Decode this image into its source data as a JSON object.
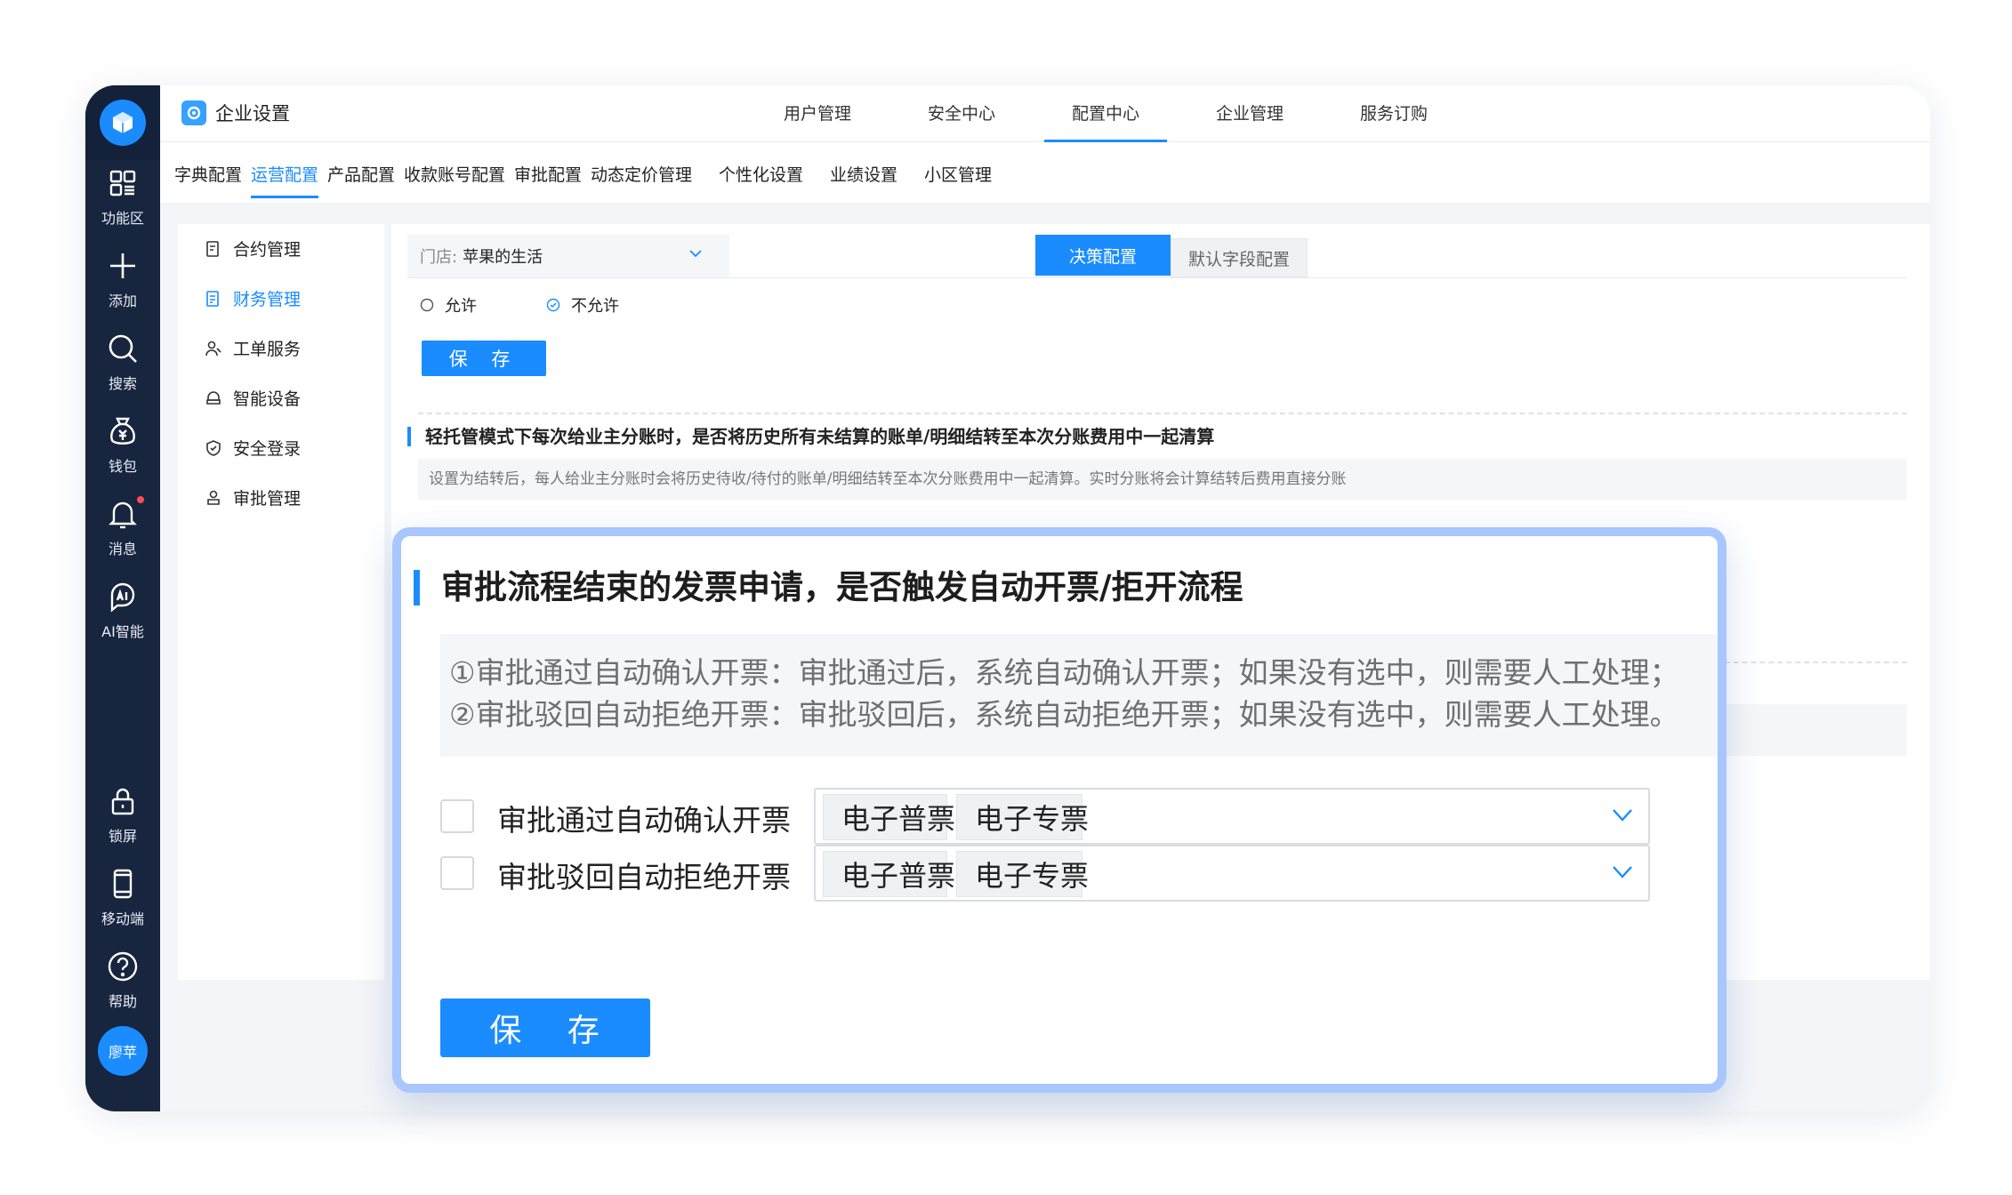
{
  "sidebar": {
    "items": [
      {
        "label": "功能区",
        "icon": "grid-icon"
      },
      {
        "label": "添加",
        "icon": "plus-icon"
      },
      {
        "label": "搜索",
        "icon": "search-icon"
      },
      {
        "label": "钱包",
        "icon": "wallet-icon"
      },
      {
        "label": "消息",
        "icon": "bell-icon"
      },
      {
        "label": "AI智能",
        "icon": "ai-icon"
      }
    ],
    "bottom_items": [
      {
        "label": "锁屏",
        "icon": "lock-icon"
      },
      {
        "label": "移动端",
        "icon": "mobile-icon"
      },
      {
        "label": "帮助",
        "icon": "help-icon"
      }
    ],
    "avatar": "廖苹",
    "accent": "#1a8cff",
    "background": "#17253f"
  },
  "header": {
    "title": "企业设置",
    "tabs": [
      "用户管理",
      "安全中心",
      "配置中心",
      "企业管理",
      "服务订购"
    ],
    "active_tab": "配置中心"
  },
  "subnav": {
    "tabs": [
      "字典配置",
      "运营配置",
      "产品配置",
      "收款账号配置",
      "审批配置",
      "动态定价管理",
      "个性化设置",
      "业绩设置",
      "小区管理"
    ],
    "active_tab": "运营配置"
  },
  "submenu": {
    "items": [
      {
        "label": "合约管理",
        "icon": "contract-icon"
      },
      {
        "label": "财务管理",
        "icon": "finance-icon"
      },
      {
        "label": "工单服务",
        "icon": "workorder-icon"
      },
      {
        "label": "智能设备",
        "icon": "device-icon"
      },
      {
        "label": "安全登录",
        "icon": "shield-icon"
      },
      {
        "label": "审批管理",
        "icon": "approval-icon"
      }
    ],
    "active_item": "财务管理"
  },
  "main": {
    "store_label": "门店:",
    "store_value": "苹果的生活",
    "segments": [
      "决策配置",
      "默认字段配置"
    ],
    "active_segment": "决策配置",
    "radio_options": [
      "允许",
      "不允许"
    ],
    "radio_selected": "不允许",
    "save_label": "保 存",
    "question_title": "轻托管模式下每次给业主分账时，是否将历史所有未结算的账单/明细结转至本次分账费用中一起清算",
    "question_desc": "设置为结转后，每人给业主分账时会将历史待收/待付的账单/明细结转至本次分账费用中一起清算。实时分账将会计算结转后费用直接分账"
  },
  "overlay": {
    "title": "审批流程结束的发票申请，是否触发自动开票/拒开流程",
    "desc_lines": [
      "①审批通过自动确认开票：审批通过后，系统自动确认开票；如果没有选中，则需要人工处理；",
      "②审批驳回自动拒绝开票：审批驳回后，系统自动拒绝开票；如果没有选中，则需要人工处理。"
    ],
    "rows": [
      {
        "label": "审批通过自动确认开票",
        "checked": false,
        "tags": [
          "电子普票",
          "电子专票"
        ]
      },
      {
        "label": "审批驳回自动拒绝开票",
        "checked": false,
        "tags": [
          "电子普票",
          "电子专票"
        ]
      }
    ],
    "save_label": "保 存",
    "border_color": "#a8c6ff"
  }
}
